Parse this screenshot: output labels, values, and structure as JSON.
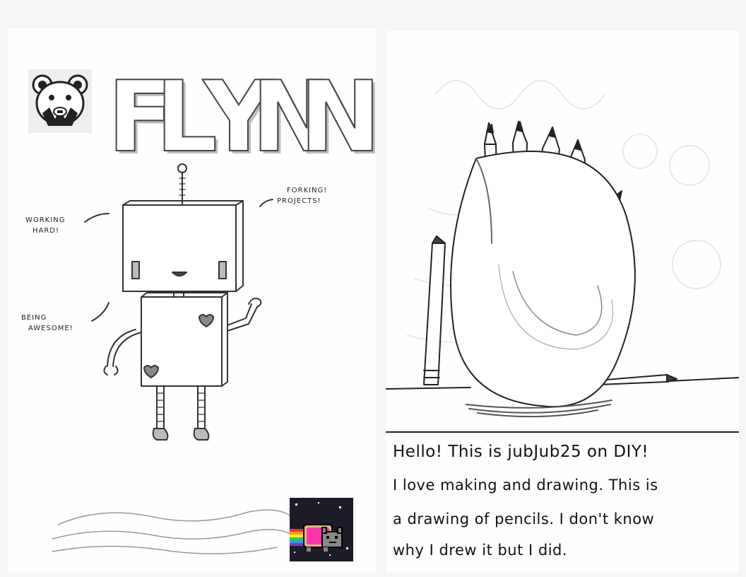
{
  "left_page": {
    "title": "FLYNN",
    "labels": {
      "working_hard": [
        "WORKING",
        "HARD!"
      ],
      "forking_projects": [
        "FORKING!",
        "PROJECTS!"
      ],
      "being_awesome": [
        "BEING",
        "AWESOME!"
      ]
    },
    "icons": {
      "top_left": "bear-face-icon",
      "bottom_right": "nyan-cat-icon"
    }
  },
  "right_page": {
    "note_lines": [
      "Hello! This is jubJub25 on DIY!",
      "I love making and drawing. This is",
      "a drawing of pencils. I don't know",
      "why I drew it but I did."
    ]
  }
}
